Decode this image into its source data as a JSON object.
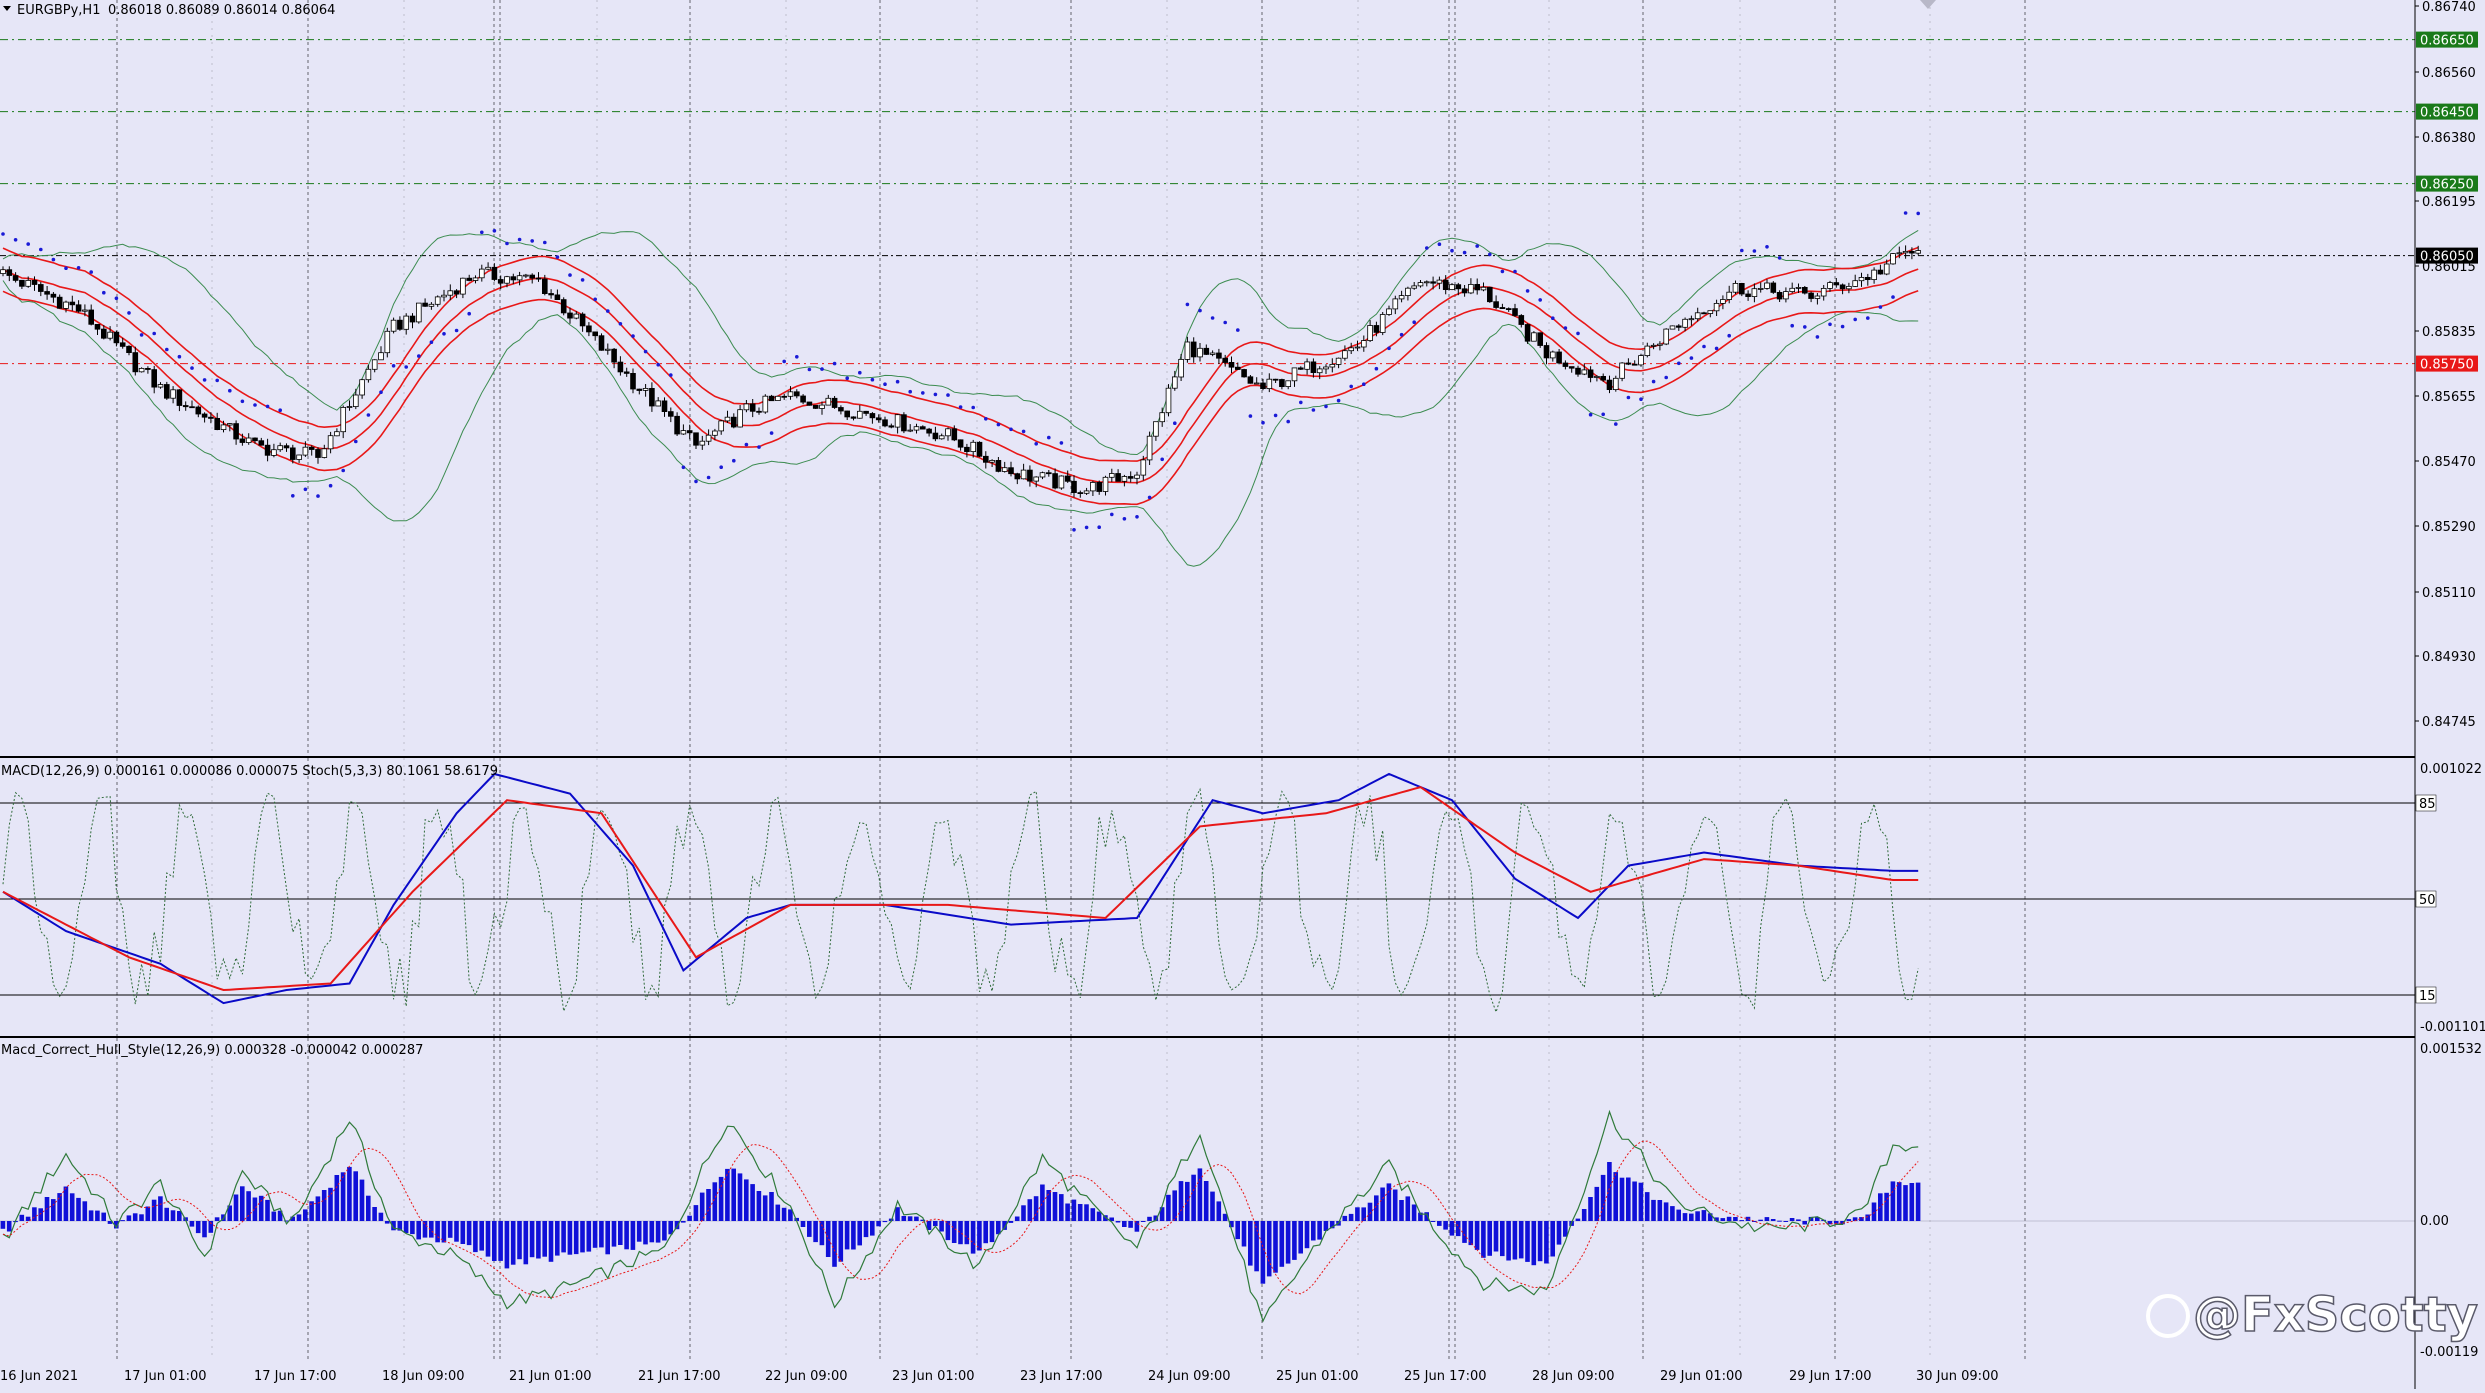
{
  "symbol": "EURGBPy,H1",
  "ohlc_text": "0.86018 0.86089 0.86014 0.86064",
  "watermark": "@FxScotty",
  "colors": {
    "background": "#e6e6f7",
    "bull": "#ffffff",
    "bear": "#000000",
    "envelope": "#e81818",
    "bollinger": "#3c8c50",
    "sar": "#1a1ad6",
    "macd_line": "#0a0ac8",
    "signal_line": "#e81818",
    "histogram": "#1010d8",
    "level_green": "#1a7a1a",
    "level_red": "#e81818"
  },
  "main_axis_labels": [
    "0.86740",
    "0.86560",
    "0.86380",
    "0.86195",
    "0.86015",
    "0.85835",
    "0.85655",
    "0.85470",
    "0.85290",
    "0.85110",
    "0.84930",
    "0.84745"
  ],
  "levels": [
    {
      "label": "0.86650",
      "value": 0.8665,
      "kind": "green"
    },
    {
      "label": "0.86450",
      "value": 0.8645,
      "kind": "green"
    },
    {
      "label": "0.86250",
      "value": 0.8625,
      "kind": "green"
    },
    {
      "label": "0.86050",
      "value": 0.8605,
      "kind": "current"
    },
    {
      "label": "0.85750",
      "value": 0.8575,
      "kind": "red"
    }
  ],
  "time_labels": [
    "16 Jun 2021",
    "17 Jun 01:00",
    "17 Jun 17:00",
    "18 Jun 09:00",
    "21 Jun 01:00",
    "21 Jun 17:00",
    "22 Jun 09:00",
    "23 Jun 01:00",
    "23 Jun 17:00",
    "24 Jun 09:00",
    "25 Jun 01:00",
    "25 Jun 17:00",
    "28 Jun 09:00",
    "29 Jun 01:00",
    "29 Jun 17:00",
    "30 Jun 09:00"
  ],
  "panel2": {
    "title": "MACD(12,26,9) 0.000161 0.000086 0.000075  Stoch(5,3,3) 80.1061 58.6179",
    "axis_top": "0.001022",
    "axis_bottom": "-0.001101",
    "stoch_levels": [
      "85",
      "50",
      "15"
    ]
  },
  "panel3": {
    "title": "Macd_Correct_Hull_Style(12,26,9) 0.000328 -0.000042 0.000287",
    "axis_top": "0.001532",
    "axis_mid": "0.00",
    "axis_bottom": "-0.00119"
  },
  "chart_data": [
    {
      "type": "candlestick",
      "title": "EURGBPy,H1",
      "ylim": [
        0.8466,
        0.8676
      ],
      "waypoints_price": [
        [
          0,
          0.86
        ],
        [
          12,
          0.859
        ],
        [
          25,
          0.8568
        ],
        [
          40,
          0.8552
        ],
        [
          50,
          0.8549
        ],
        [
          62,
          0.8585
        ],
        [
          75,
          0.86
        ],
        [
          85,
          0.8598
        ],
        [
          100,
          0.857
        ],
        [
          110,
          0.8552
        ],
        [
          118,
          0.8562
        ],
        [
          125,
          0.8566
        ],
        [
          135,
          0.8562
        ],
        [
          150,
          0.8555
        ],
        [
          160,
          0.8545
        ],
        [
          172,
          0.854
        ],
        [
          180,
          0.8545
        ],
        [
          188,
          0.858
        ],
        [
          200,
          0.8568
        ],
        [
          215,
          0.858
        ],
        [
          225,
          0.8598
        ],
        [
          235,
          0.8595
        ],
        [
          245,
          0.8578
        ],
        [
          255,
          0.857
        ],
        [
          265,
          0.8585
        ],
        [
          275,
          0.8596
        ],
        [
          287,
          0.8594
        ],
        [
          297,
          0.86
        ],
        [
          302,
          0.8606
        ]
      ],
      "last_close": 0.86064
    },
    {
      "type": "line",
      "title": "MACD(12,26,9) / Stoch(5,3,3)",
      "ylim": [
        -0.001101,
        0.001022
      ],
      "series": [
        {
          "name": "MACD",
          "waypoints": [
            [
              0,
              0.0
            ],
            [
              10,
              -0.0003
            ],
            [
              25,
              -0.00055
            ],
            [
              35,
              -0.00085
            ],
            [
              45,
              -0.00075
            ],
            [
              55,
              -0.0007
            ],
            [
              62,
              -0.0001
            ],
            [
              72,
              0.0006
            ],
            [
              78,
              0.0009
            ],
            [
              90,
              0.00075
            ],
            [
              100,
              0.0002
            ],
            [
              108,
              -0.0006
            ],
            [
              118,
              -0.0002
            ],
            [
              125,
              -0.0001
            ],
            [
              140,
              -0.0001
            ],
            [
              160,
              -0.00025
            ],
            [
              180,
              -0.0002
            ],
            [
              192,
              0.0007
            ],
            [
              200,
              0.0006
            ],
            [
              212,
              0.0007
            ],
            [
              220,
              0.0009
            ],
            [
              230,
              0.0007
            ],
            [
              240,
              0.0001
            ],
            [
              250,
              -0.0002
            ],
            [
              258,
              0.0002
            ],
            [
              270,
              0.0003
            ],
            [
              285,
              0.0002
            ],
            [
              300,
              0.00016
            ]
          ]
        },
        {
          "name": "Signal",
          "waypoints": [
            [
              0,
              0.0
            ],
            [
              20,
              -0.0005
            ],
            [
              35,
              -0.00075
            ],
            [
              52,
              -0.0007
            ],
            [
              65,
              0.0
            ],
            [
              80,
              0.0007
            ],
            [
              95,
              0.0006
            ],
            [
              110,
              -0.0005
            ],
            [
              125,
              -0.0001
            ],
            [
              150,
              -0.0001
            ],
            [
              175,
              -0.0002
            ],
            [
              190,
              0.0005
            ],
            [
              210,
              0.0006
            ],
            [
              225,
              0.0008
            ],
            [
              240,
              0.0003
            ],
            [
              252,
              0.0
            ],
            [
              270,
              0.00025
            ],
            [
              285,
              0.0002
            ],
            [
              300,
              9e-05
            ]
          ]
        }
      ]
    },
    {
      "type": "bar",
      "title": "Macd_Correct_Hull_Style(12,26,9)",
      "ylim": [
        -0.00119,
        0.001532
      ],
      "histogram_waypoints": [
        [
          0,
          -0.0001
        ],
        [
          10,
          0.0003
        ],
        [
          18,
          -5e-05
        ],
        [
          25,
          0.0002
        ],
        [
          32,
          -0.00015
        ],
        [
          38,
          0.0003
        ],
        [
          46,
          0.0
        ],
        [
          55,
          0.0005
        ],
        [
          62,
          -0.0001
        ],
        [
          72,
          -0.0002
        ],
        [
          80,
          -0.0004
        ],
        [
          92,
          -0.0003
        ],
        [
          105,
          -0.0002
        ],
        [
          115,
          0.0005
        ],
        [
          125,
          0.0001
        ],
        [
          132,
          -0.0004
        ],
        [
          142,
          0.0001
        ],
        [
          155,
          -0.0003
        ],
        [
          165,
          0.0003
        ],
        [
          180,
          -0.0001
        ],
        [
          190,
          0.0005
        ],
        [
          200,
          -0.0006
        ],
        [
          210,
          -0.0001
        ],
        [
          220,
          0.0003
        ],
        [
          235,
          -0.0003
        ],
        [
          245,
          -0.0004
        ],
        [
          255,
          0.0005
        ],
        [
          265,
          0.0001
        ],
        [
          280,
          0.0
        ],
        [
          295,
          0.0
        ],
        [
          300,
          0.00035
        ]
      ]
    }
  ]
}
